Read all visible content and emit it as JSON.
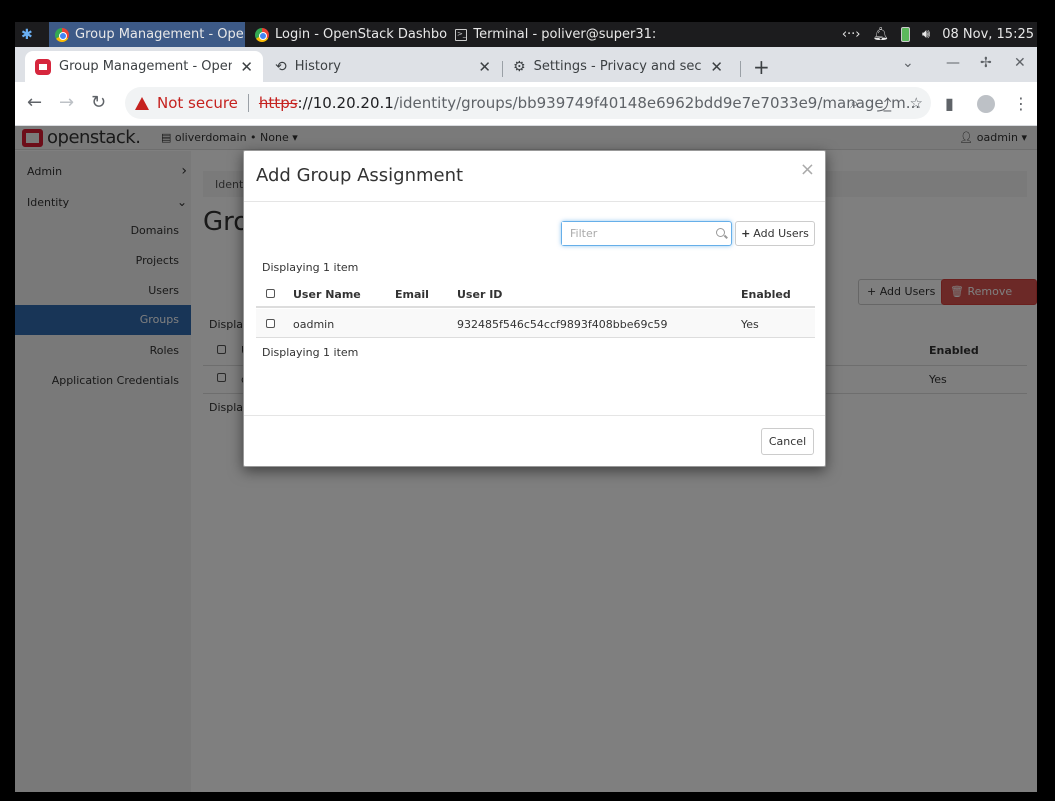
{
  "taskbar": {
    "items": [
      {
        "label": "Group Management - Open..."
      },
      {
        "label": "Login - OpenStack Dashboar..."
      },
      {
        "label": "Terminal - poliver@super31: ~"
      }
    ],
    "clock": "08 Nov, 15:25"
  },
  "browser": {
    "tabs": [
      {
        "title": "Group Management - OpenStack"
      },
      {
        "title": "History"
      },
      {
        "title": "Settings - Privacy and security"
      }
    ],
    "address": {
      "security_label": "Not secure",
      "scheme": "https",
      "host": "://10.20.20.1",
      "path": "/identity/groups/bb939749f40148e6962bdd9e7e7033e9/manage_m..."
    }
  },
  "header": {
    "logo_text": "openstack.",
    "domain_selector": "oliverdomain • None",
    "user": "oadmin"
  },
  "sidebar": {
    "sections": [
      {
        "label": "Admin"
      },
      {
        "label": "Identity"
      }
    ],
    "items": [
      {
        "label": "Domains"
      },
      {
        "label": "Projects"
      },
      {
        "label": "Users"
      },
      {
        "label": "Groups"
      },
      {
        "label": "Roles"
      },
      {
        "label": "Application Credentials"
      }
    ]
  },
  "background": {
    "breadcrumb": "Identit",
    "title": "Gro",
    "add_users": "Add Users",
    "remove_users": "Remove Users",
    "displaying_top": "Display",
    "displaying_bottom": "Display",
    "col_enabled": "Enabled",
    "row_enabled": "Yes",
    "row_partial": "c",
    "col_partial": "U"
  },
  "modal": {
    "title": "Add Group Assignment",
    "close_label": "×",
    "filter_placeholder": "Filter",
    "add_users_label": "Add Users",
    "displaying_top": "Displaying 1 item",
    "displaying_bottom": "Displaying 1 item",
    "columns": {
      "user_name": "User Name",
      "email": "Email",
      "user_id": "User ID",
      "enabled": "Enabled"
    },
    "rows": [
      {
        "user_name": "oadmin",
        "email": "",
        "user_id": "932485f546c54ccf9893f408bbe69c59",
        "enabled": "Yes"
      }
    ],
    "cancel_label": "Cancel"
  }
}
